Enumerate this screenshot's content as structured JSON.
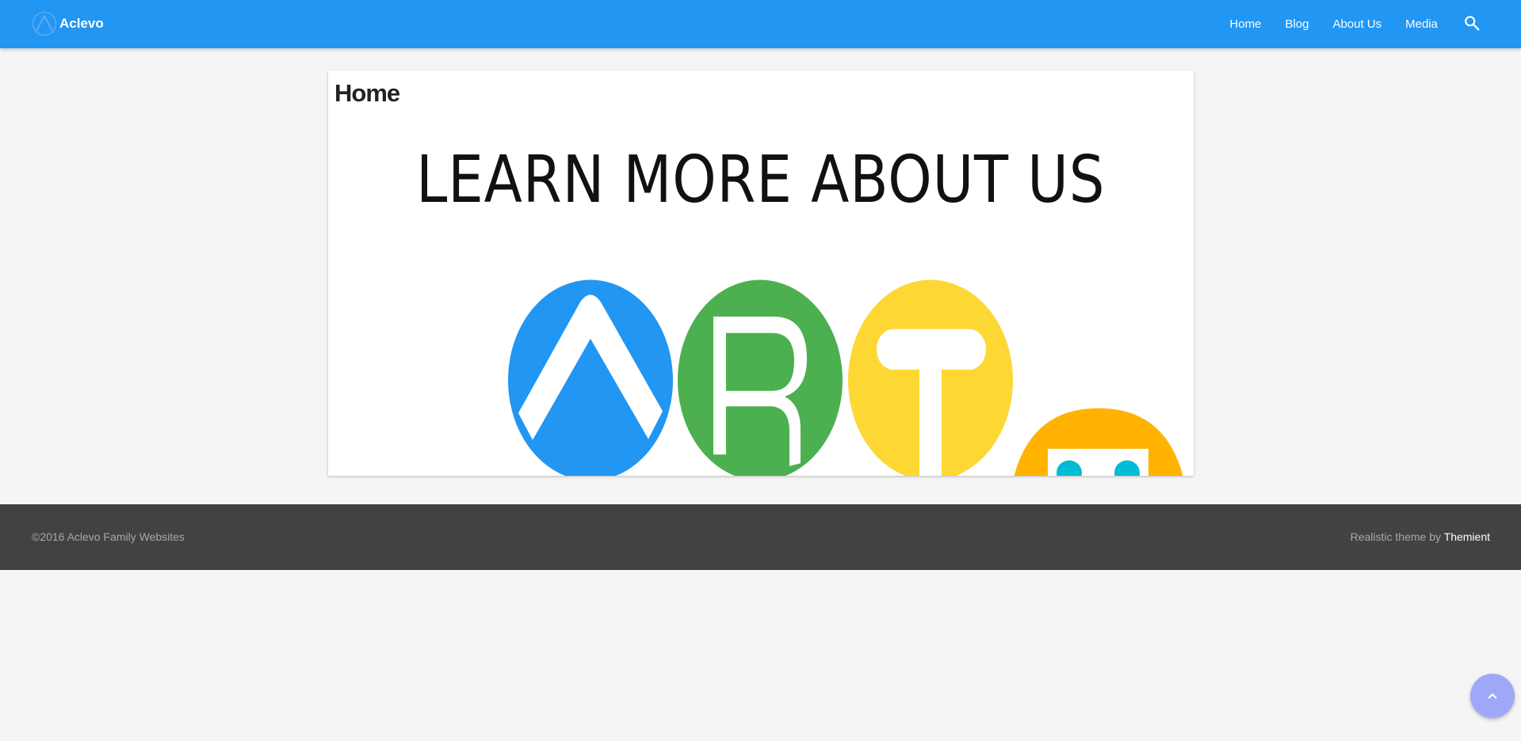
{
  "header": {
    "brand_name": "Aclevo",
    "brand_icon": "aclevo-logo-icon",
    "background_color": "#2196f3",
    "nav": [
      {
        "label": "Home"
      },
      {
        "label": "Blog"
      },
      {
        "label": "About Us"
      },
      {
        "label": "Media"
      }
    ],
    "search_icon": "search-icon"
  },
  "main": {
    "page_title": "Home",
    "banner": {
      "headline": "LEARN MORE ABOUT US",
      "logo_colors": {
        "blue": "#2196f3",
        "green": "#4caf50",
        "yellow": "#fdd835",
        "orange": "#ffb300",
        "cyan": "#00bcd4"
      }
    }
  },
  "footer": {
    "copyright": "©2016 Aclevo Family Websites",
    "credit_prefix": "Realistic theme by ",
    "credit_link": "Themient",
    "background_color": "#424242"
  },
  "back_to_top_icon": "chevron-up-icon"
}
